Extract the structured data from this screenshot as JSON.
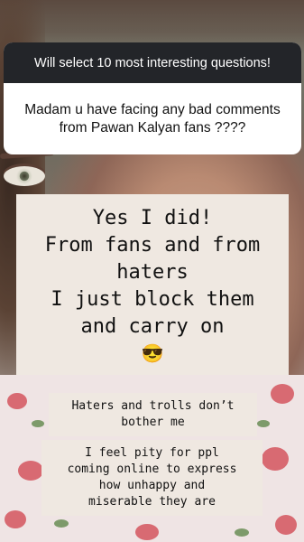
{
  "question_sticker": {
    "header": "Will select 10 most interesting questions!",
    "question": "Madam u have facing any bad comments from Pawan Kalyan fans ????"
  },
  "answer": {
    "lines": [
      "Yes I did!",
      "From fans and from",
      "haters",
      "I just block them",
      "and carry on"
    ],
    "emoji": "😎"
  },
  "caption_two": {
    "lines": [
      "Haters and trolls don’t",
      "bother me"
    ]
  },
  "caption_three": {
    "lines": [
      "I feel pity for ppl",
      "coming online to express",
      "how unhappy and",
      "miserable they are"
    ]
  },
  "colors": {
    "sticker_header_bg": "#232529",
    "text_block_bg": "#efe8e1"
  }
}
